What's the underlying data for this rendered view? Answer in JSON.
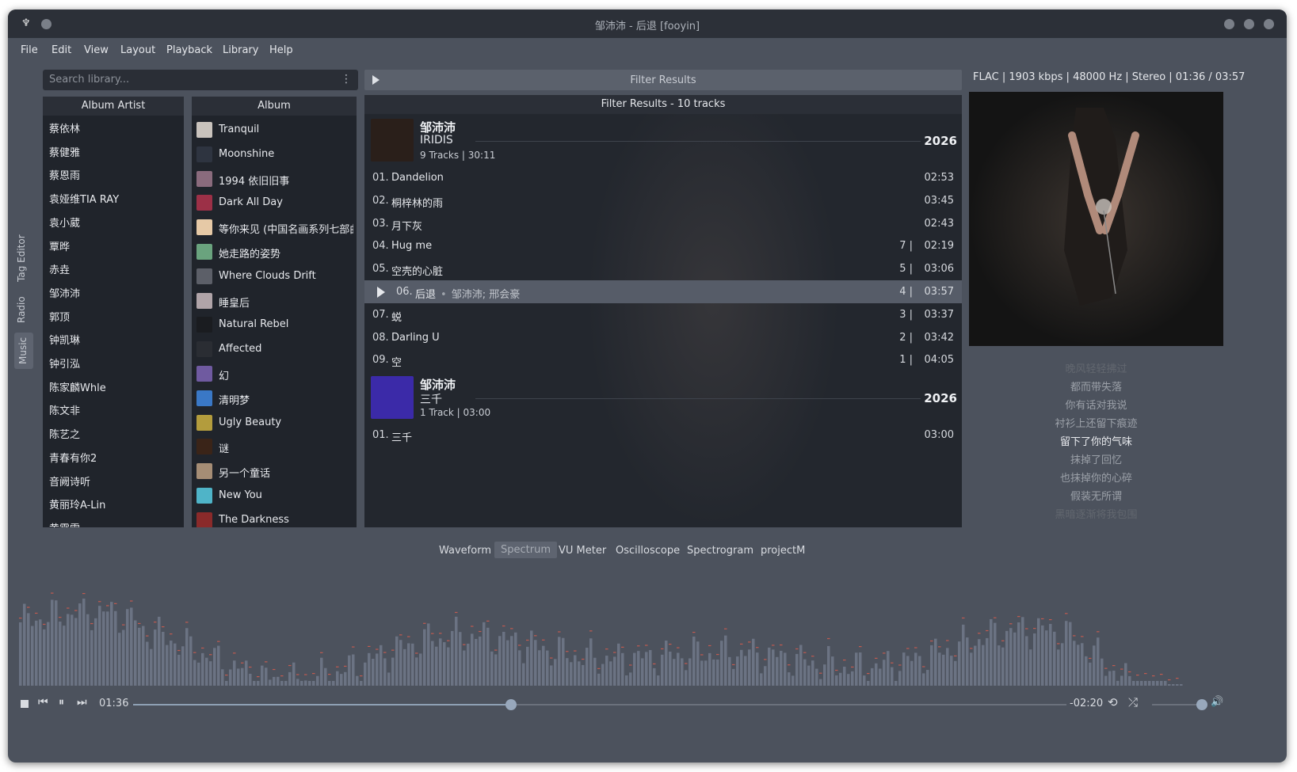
{
  "window": {
    "title": "邹沛沛 - 后退 [fooyin]"
  },
  "menu": [
    "File",
    "Edit",
    "View",
    "Layout",
    "Playback",
    "Library",
    "Help"
  ],
  "search": {
    "placeholder": "Search library..."
  },
  "side_tabs": [
    "Tag Editor",
    "Radio",
    "Music"
  ],
  "artists": {
    "header": "Album Artist",
    "items": [
      "蔡依林",
      "蔡健雅",
      "蔡恩雨",
      "袁娅维TIA RAY",
      "袁小葳",
      "覃晔",
      "赤垚",
      "邹沛沛",
      "郭顶",
      "钟凯琳",
      "钟引泓",
      "陈家麟Whle",
      "陈文非",
      "陈艺之",
      "青春有你2",
      "音阙诗听",
      "黄丽玲A-Lin",
      "黄霄雲"
    ]
  },
  "albums": {
    "header": "Album",
    "items": [
      {
        "name": "Tranquil",
        "color": "#c9c3bd"
      },
      {
        "name": "Moonshine",
        "color": "#2e3440"
      },
      {
        "name": "1994 依旧旧事",
        "color": "#8a6b7d"
      },
      {
        "name": "Dark All Day",
        "color": "#9c3047"
      },
      {
        "name": "等你来见 (中国名画系列七部曲)",
        "color": "#e6c9a6"
      },
      {
        "name": "她走路的姿势",
        "color": "#6aa37e"
      },
      {
        "name": "Where Clouds Drift",
        "color": "#5c5f68"
      },
      {
        "name": "睡皇后",
        "color": "#b0a4a8"
      },
      {
        "name": "Natural Rebel",
        "color": "#1a1c20"
      },
      {
        "name": "Affected",
        "color": "#2a2d33"
      },
      {
        "name": "幻",
        "color": "#6f5aa0"
      },
      {
        "name": "清明梦",
        "color": "#3a78c6"
      },
      {
        "name": "Ugly Beauty",
        "color": "#b39c3d"
      },
      {
        "name": "谜",
        "color": "#3a2418"
      },
      {
        "name": "另一个童话",
        "color": "#a58d75"
      },
      {
        "name": "New You",
        "color": "#4fb4c8"
      },
      {
        "name": "The Darkness",
        "color": "#8a2a2a"
      }
    ]
  },
  "filter": {
    "title": "Filter Results",
    "header": "Filter Results - 10 tracks"
  },
  "groups": [
    {
      "artist": "邹沛沛",
      "album": "IRIDIS",
      "info": "9 Tracks | 30:11",
      "year": "2026",
      "art_color": "#2a1f1a",
      "tracks": [
        {
          "num": "01.",
          "title": "Dandelion",
          "count": "",
          "dur": "02:53"
        },
        {
          "num": "02.",
          "title": "桐梓林的雨",
          "count": "",
          "dur": "03:45"
        },
        {
          "num": "03.",
          "title": "月下灰",
          "count": "",
          "dur": "02:43"
        },
        {
          "num": "04.",
          "title": "Hug me",
          "count": "7 |",
          "dur": "02:19"
        },
        {
          "num": "05.",
          "title": "空壳的心脏",
          "count": "5 |",
          "dur": "03:06"
        },
        {
          "num": "06.",
          "title": "后退",
          "artists": "邹沛沛; 邢会豪",
          "count": "4 |",
          "dur": "03:57",
          "playing": true
        },
        {
          "num": "07.",
          "title": "蜕",
          "count": "3 |",
          "dur": "03:37"
        },
        {
          "num": "08.",
          "title": "Darling U",
          "count": "2 |",
          "dur": "03:42"
        },
        {
          "num": "09.",
          "title": "空",
          "count": "1 |",
          "dur": "04:05"
        }
      ]
    },
    {
      "artist": "邹沛沛",
      "album": "三千",
      "info": "1 Track | 03:00",
      "year": "2026",
      "art_color": "#3b2aa8",
      "tracks": [
        {
          "num": "01.",
          "title": "三千",
          "count": "",
          "dur": "03:00"
        }
      ]
    }
  ],
  "now_playing": {
    "info": "FLAC | 1903 kbps | 48000 Hz | Stereo | 01:36 / 03:57"
  },
  "lyrics": [
    {
      "text": "晚风轻轻拂过",
      "state": "faded"
    },
    {
      "text": "都而带失落",
      "state": "dim"
    },
    {
      "text": "你有话对我说",
      "state": "dim"
    },
    {
      "text": "衬衫上还留下痕迹",
      "state": "dim"
    },
    {
      "text": "留下了你的气味",
      "state": "current"
    },
    {
      "text": "抹掉了回忆",
      "state": "dim"
    },
    {
      "text": "也抹掉你的心碎",
      "state": "dim"
    },
    {
      "text": "假装无所谓",
      "state": "dim"
    },
    {
      "text": "黑暗逐渐将我包围",
      "state": "faded"
    }
  ],
  "visualizer": {
    "tabs": [
      "Waveform",
      "Spectrum",
      "VU Meter",
      "Oscilloscope",
      "Spectrogram",
      "projectM"
    ],
    "active": "Spectrum"
  },
  "controls": {
    "elapsed": "01:36",
    "remaining": "-02:20",
    "progress": 0.405,
    "volume": 1.0
  },
  "colors": {
    "accent": "#98a8bc",
    "playing_row": "#565c68",
    "peak": "#c05a50"
  }
}
